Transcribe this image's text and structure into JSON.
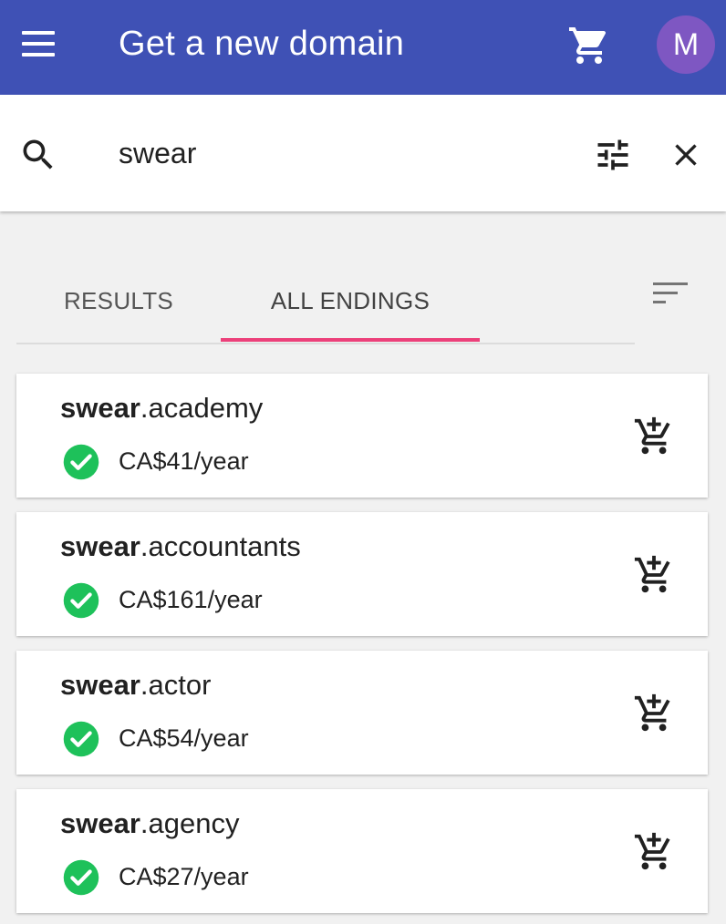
{
  "app_bar": {
    "title": "Get a new domain",
    "avatar_initial": "M",
    "background": "#3f51b5",
    "avatar_color": "#7e57c2",
    "icons": [
      "menu-icon",
      "cart-icon"
    ]
  },
  "search": {
    "query": "swear",
    "icons": [
      "search-icon",
      "tune-icon",
      "close-icon"
    ]
  },
  "tabs": [
    {
      "label": "RESULTS",
      "active": false
    },
    {
      "label": "ALL ENDINGS",
      "active": true
    }
  ],
  "accent_color": "#ec407a",
  "status_color": "#1ec15a",
  "results": [
    {
      "name": "swear",
      "ending": ".academy",
      "price": "CA$41/year",
      "available": true
    },
    {
      "name": "swear",
      "ending": ".accountants",
      "price": "CA$161/year",
      "available": true
    },
    {
      "name": "swear",
      "ending": ".actor",
      "price": "CA$54/year",
      "available": true
    },
    {
      "name": "swear",
      "ending": ".agency",
      "price": "CA$27/year",
      "available": true
    }
  ]
}
